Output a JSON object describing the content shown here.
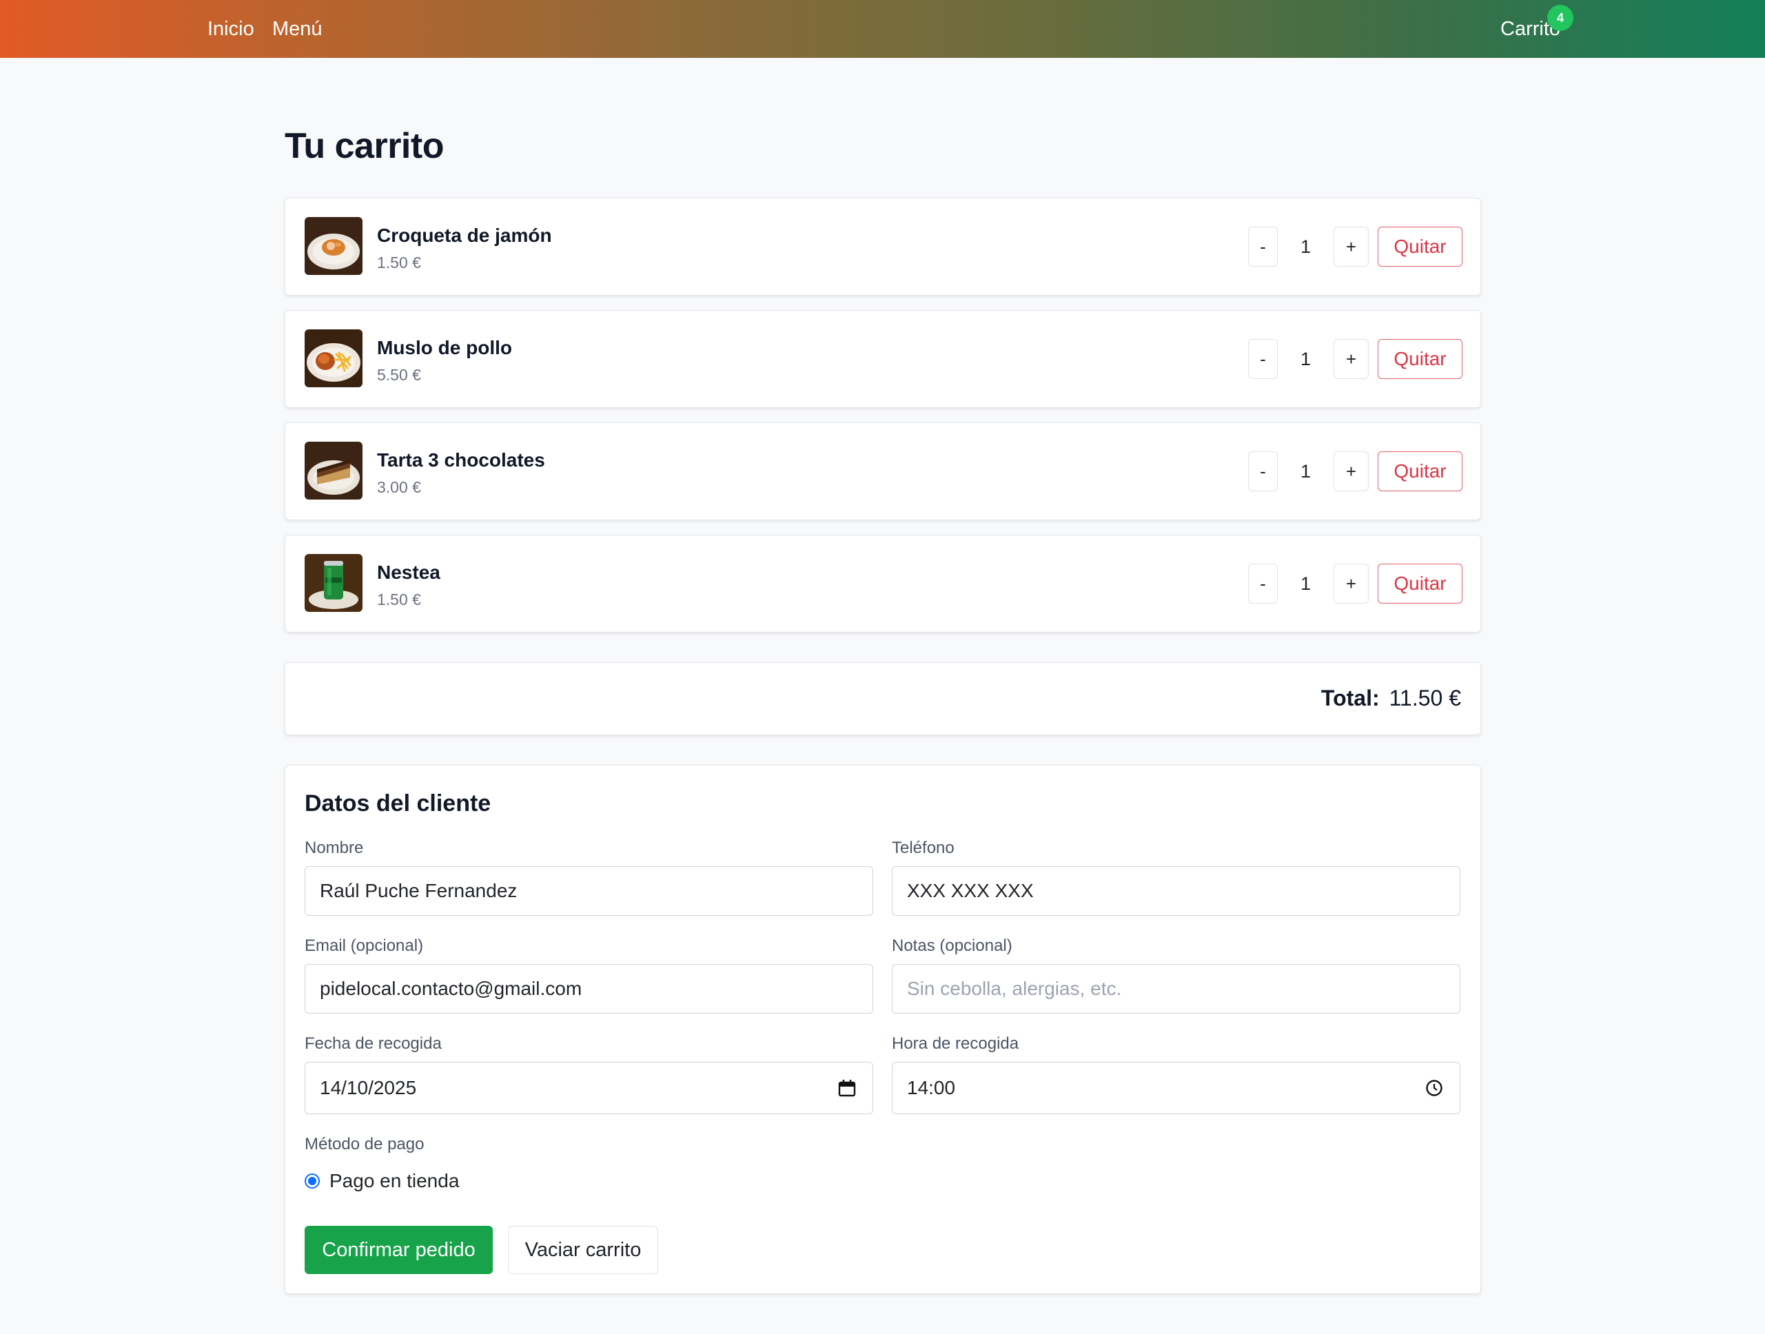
{
  "nav": {
    "home_label": "Inicio",
    "menu_label": "Menú",
    "cart_label": "Carrito",
    "cart_count": "4"
  },
  "page_title": "Tu carrito",
  "cart": {
    "items": [
      {
        "name": "Croqueta de jamón",
        "price": "1.50 €",
        "quantity": "1",
        "icon": "croqueta-image"
      },
      {
        "name": "Muslo de pollo",
        "price": "5.50 €",
        "quantity": "1",
        "icon": "chicken-fries-image"
      },
      {
        "name": "Tarta 3 chocolates",
        "price": "3.00 €",
        "quantity": "1",
        "icon": "chocolate-cake-image"
      },
      {
        "name": "Nestea",
        "price": "1.50 €",
        "quantity": "1",
        "icon": "nestea-can-image"
      }
    ],
    "decrement_label": "-",
    "increment_label": "+",
    "remove_label": "Quitar",
    "total_label": "Total:",
    "total_value": "11.50 €"
  },
  "customer_form": {
    "title": "Datos del cliente",
    "name": {
      "label": "Nombre",
      "value": "Raúl Puche Fernandez"
    },
    "phone": {
      "label": "Teléfono",
      "value": "XXX XXX XXX"
    },
    "email": {
      "label": "Email (opcional)",
      "value": "pidelocal.contacto@gmail.com"
    },
    "notes": {
      "label": "Notas (opcional)",
      "placeholder": "Sin cebolla, alergias, etc.",
      "value": ""
    },
    "pickup_date": {
      "label": "Fecha de recogida",
      "value": "14/10/2025",
      "icon": "calendar-icon"
    },
    "pickup_time": {
      "label": "Hora de recogida",
      "value": "14:00",
      "icon": "clock-icon"
    },
    "payment": {
      "label": "Método de pago",
      "option": "Pago en tienda",
      "selected": true
    },
    "confirm_label": "Confirmar pedido",
    "empty_label": "Vaciar carrito"
  },
  "colors": {
    "confirm_green": "#16a34a",
    "remove_red": "#dc3545",
    "badge_green": "#22c55e",
    "radio_blue": "#0d6efd"
  }
}
